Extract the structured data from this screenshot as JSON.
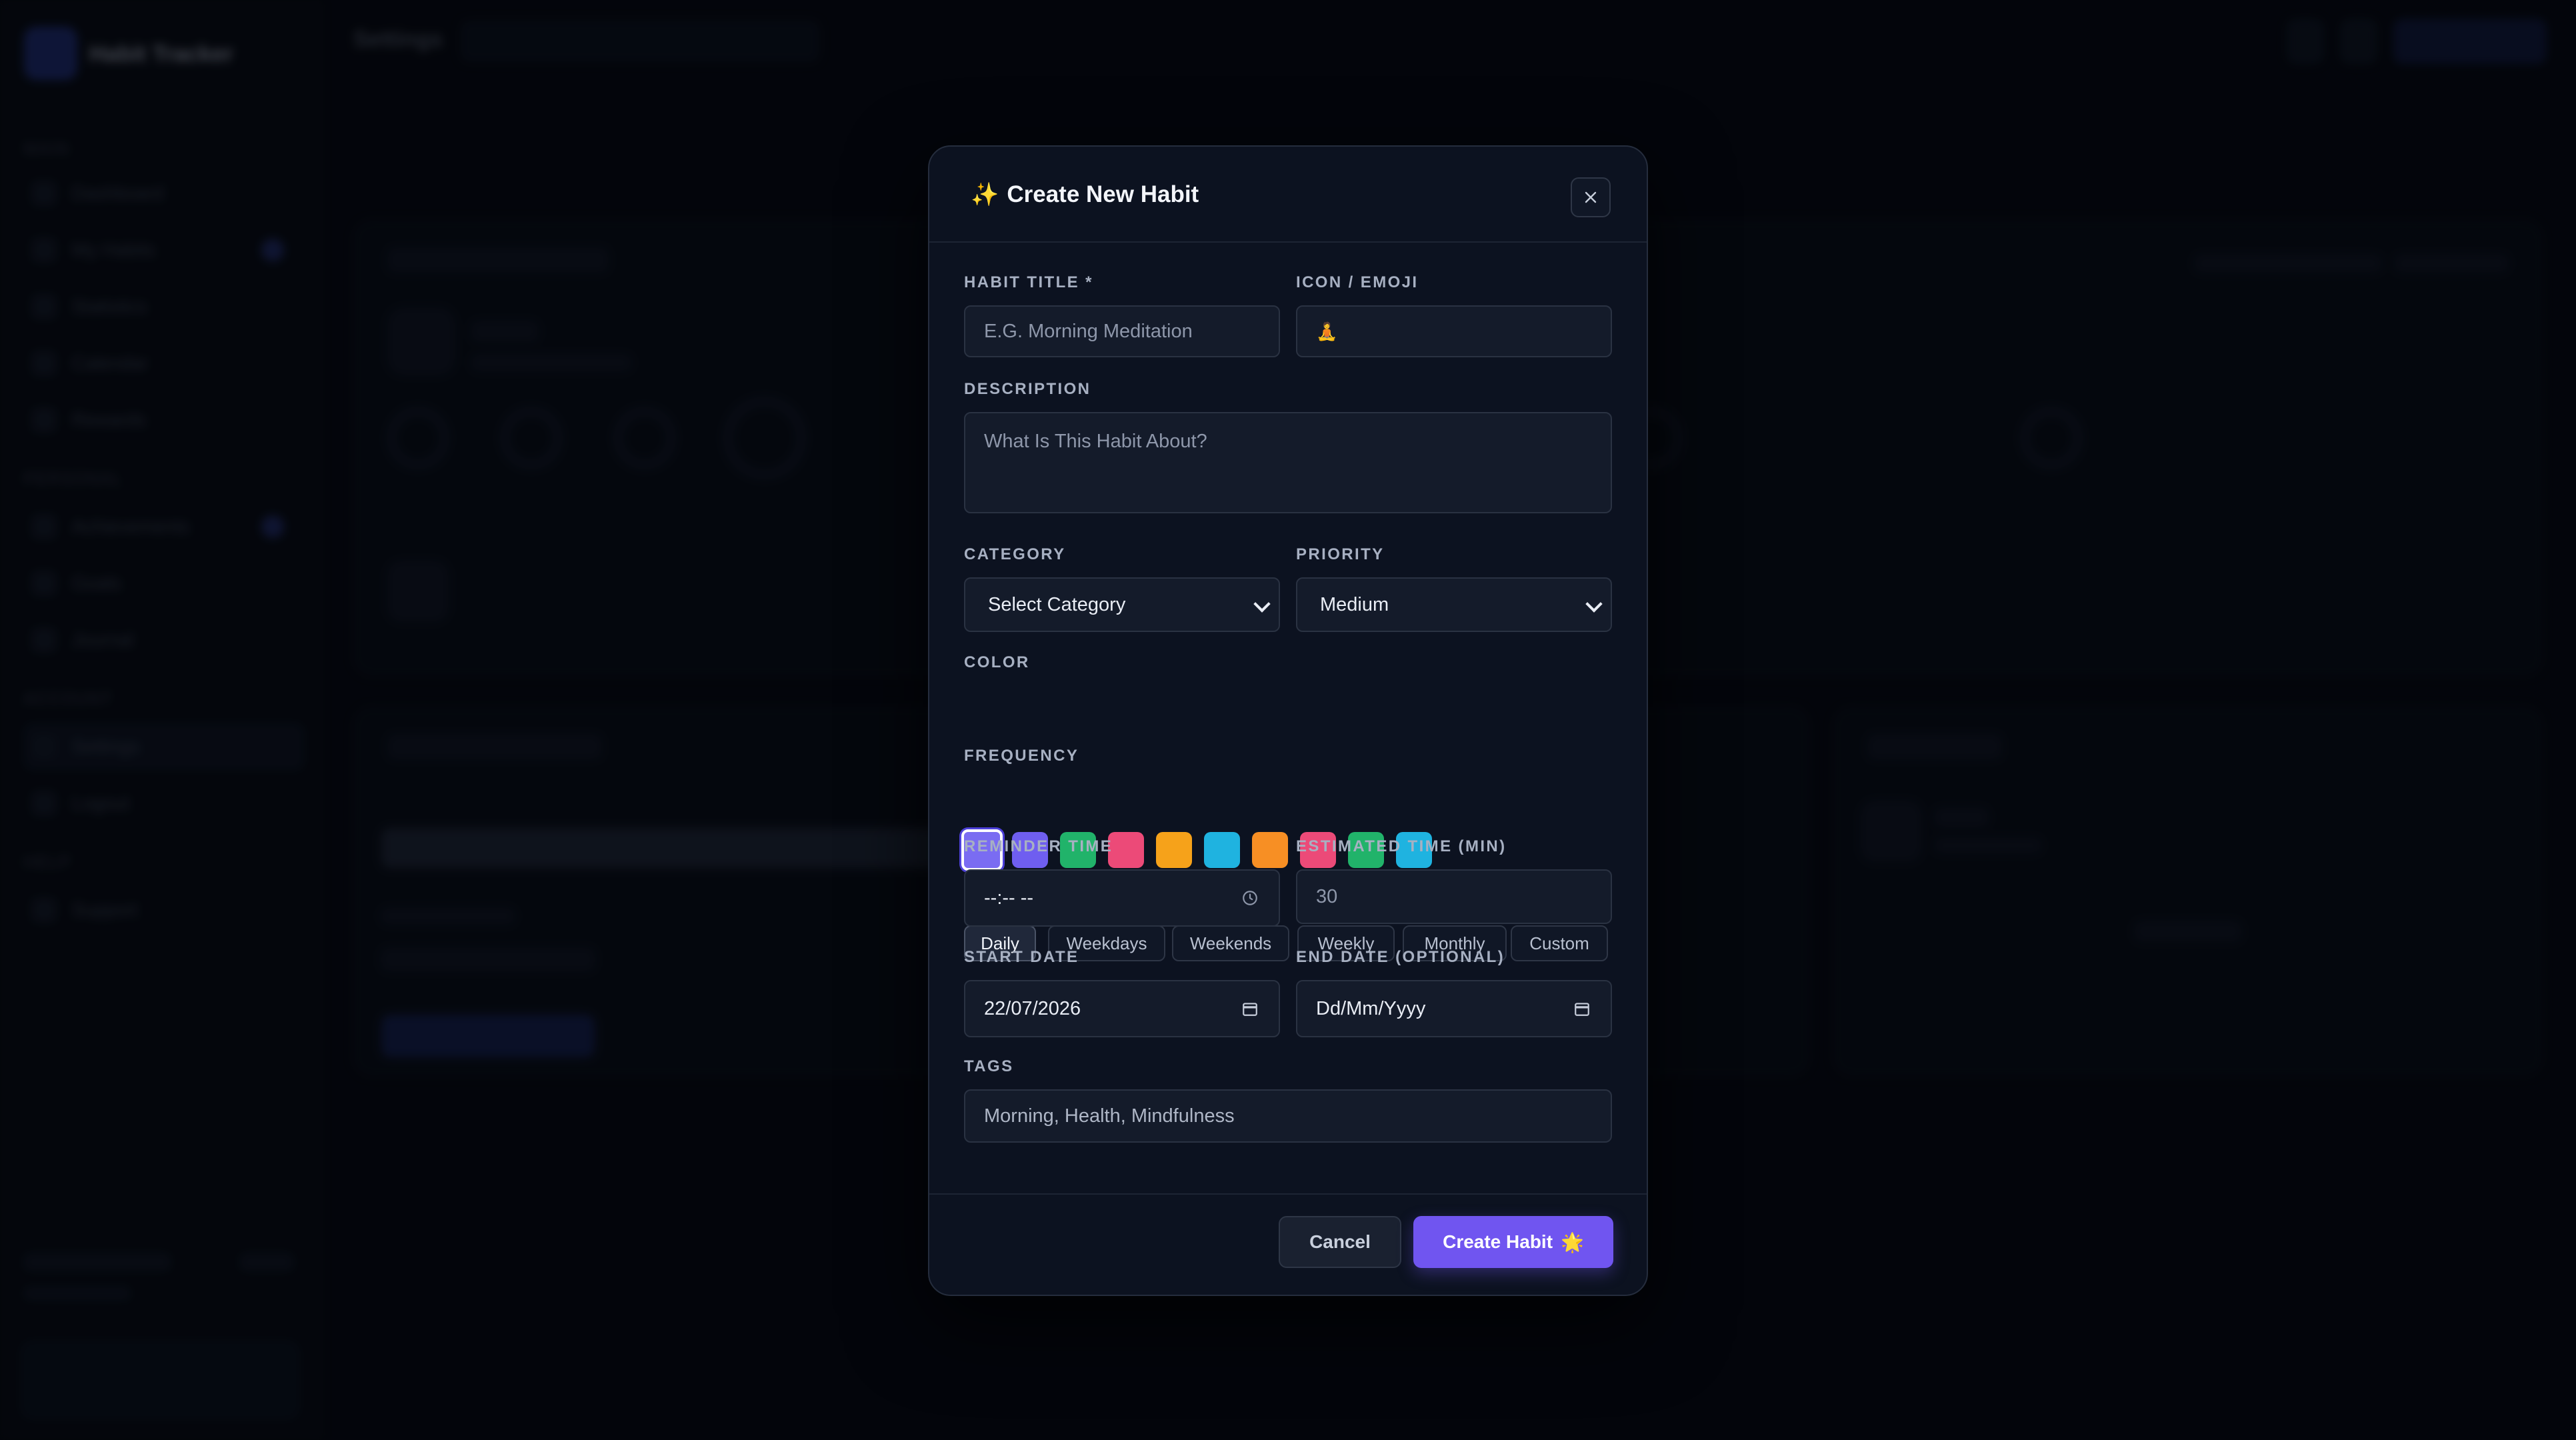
{
  "background": {
    "brand": "Habit Tracker",
    "page_title": "Settings"
  },
  "modal": {
    "title": "Create New Habit",
    "title_icon": "sparkles-icon",
    "fields": {
      "habit_title": {
        "label": "HABIT TITLE *",
        "placeholder": "E.G. Morning Meditation"
      },
      "icon": {
        "label": "ICON / EMOJI",
        "value": "🧘"
      },
      "description": {
        "label": "DESCRIPTION",
        "placeholder": "What Is This Habit About?"
      },
      "category": {
        "label": "CATEGORY",
        "value": "Select Category"
      },
      "priority": {
        "label": "PRIORITY",
        "value": "Medium"
      },
      "color": {
        "label": "COLOR",
        "swatches": [
          "#7a6cf2",
          "#6f5ef0",
          "#21b36a",
          "#ec4a78",
          "#f6a21a",
          "#1fb3e0",
          "#f78f24",
          "#ec4a78",
          "#21b36a",
          "#1fb3e0"
        ],
        "selected_index": 0
      },
      "frequency": {
        "label": "FREQUENCY",
        "options": [
          "Daily",
          "Weekdays",
          "Weekends",
          "Weekly",
          "Monthly",
          "Custom"
        ],
        "selected": "Daily"
      },
      "reminder_time": {
        "label": "REMINDER TIME",
        "value": "--:-- --"
      },
      "estimated_time": {
        "label": "ESTIMATED TIME (MIN)",
        "value": "30"
      },
      "start_date": {
        "label": "START DATE",
        "value": "22/07/2026"
      },
      "end_date": {
        "label": "END DATE (OPTIONAL)",
        "value": "Dd/Mm/Yyyy"
      },
      "tags": {
        "label": "TAGS",
        "value": "Morning, Health, Mindfulness"
      }
    },
    "buttons": {
      "cancel": "Cancel",
      "create": "Create Habit",
      "create_icon": "star-icon"
    },
    "accent_color": "#7055f0"
  }
}
